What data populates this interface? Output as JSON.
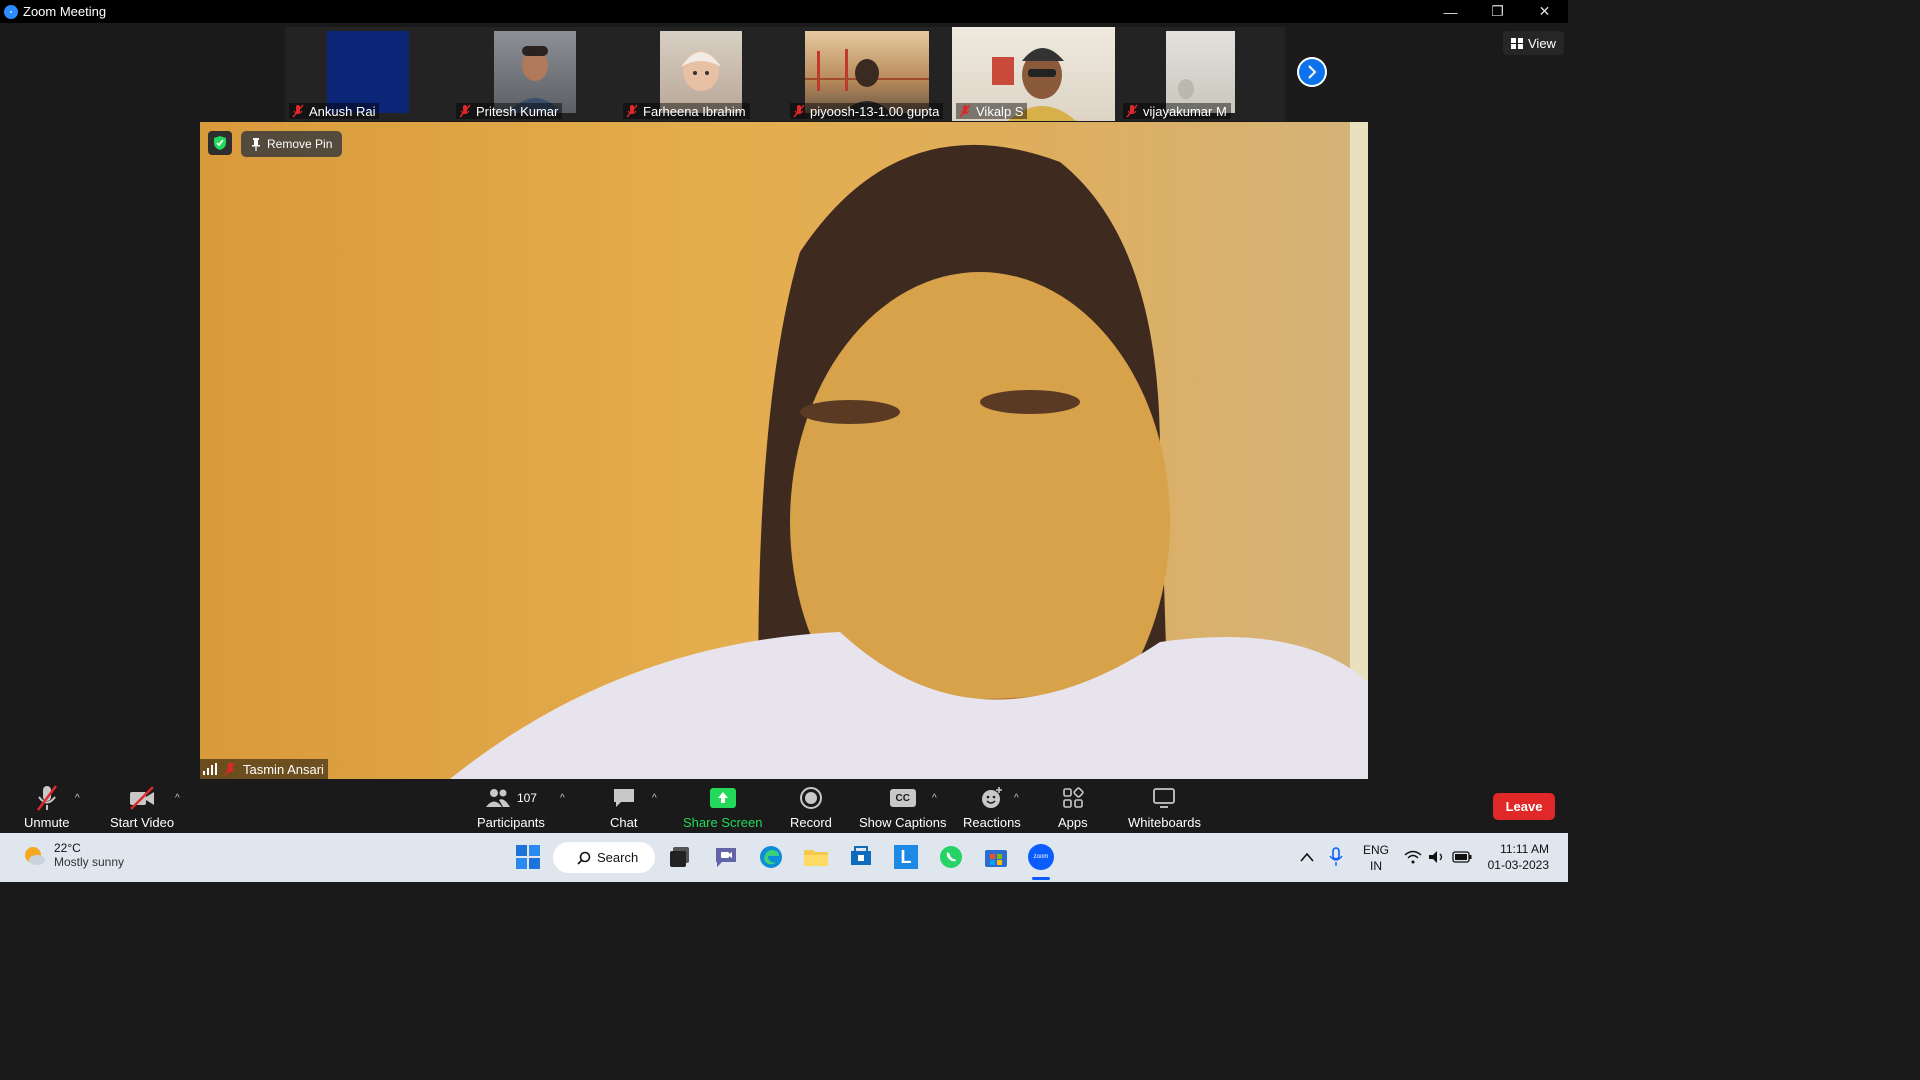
{
  "window": {
    "title": "Zoom Meeting",
    "controls": [
      "—",
      "❐",
      "✕"
    ]
  },
  "gallery": {
    "participants": [
      {
        "name": "Ankush Rai",
        "tile": "#0a2a7a"
      },
      {
        "name": "Pritesh Kumar",
        "tile": "#6b6f74"
      },
      {
        "name": "Farheena Ibrahim",
        "tile": "#c9b8a5"
      },
      {
        "name": "piyoosh-13-1.00 gupta",
        "tile": "#9a7a52"
      },
      {
        "name": "Vikalp S",
        "tile": "#e9e3d8"
      },
      {
        "name": "vijayakumar M",
        "tile": "#d9d6cf"
      }
    ],
    "view_label": "View"
  },
  "main_video": {
    "remove_pin_label": "Remove Pin",
    "speaker_name": "Tasmin Ansari"
  },
  "toolbar": {
    "unmute": "Unmute",
    "start_video": "Start Video",
    "participants": "Participants",
    "participants_count": "107",
    "chat": "Chat",
    "share_screen": "Share Screen",
    "record": "Record",
    "show_captions": "Show Captions",
    "cc": "CC",
    "reactions": "Reactions",
    "apps": "Apps",
    "whiteboards": "Whiteboards",
    "leave": "Leave"
  },
  "taskbar": {
    "temperature": "22°C",
    "weather": "Mostly sunny",
    "search": "Search",
    "language_line1": "ENG",
    "language_line2": "IN",
    "time": "11:11 AM",
    "date": "01-03-2023",
    "zoom_icon_text": "zoom",
    "l_icon_text": "L"
  }
}
